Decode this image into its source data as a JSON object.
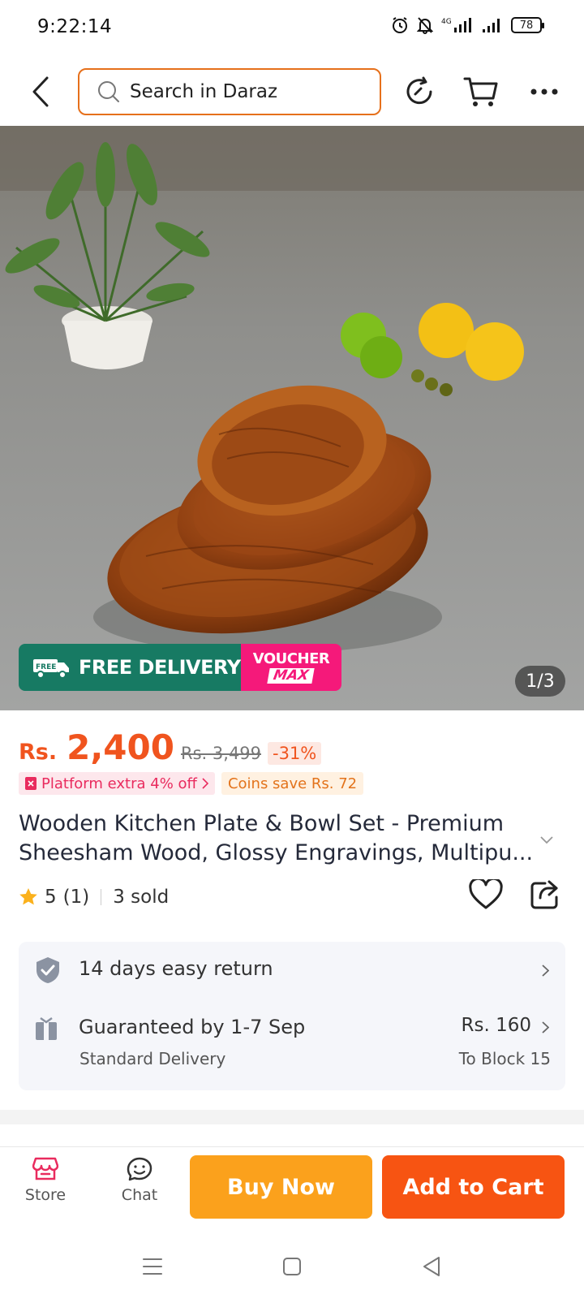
{
  "status_bar": {
    "time": "9:22:14",
    "network": "4G",
    "battery": "78"
  },
  "header": {
    "search_placeholder": "Search in Daraz"
  },
  "hero": {
    "promo_free_badge": "FREE",
    "promo_delivery": "FREE DELIVERY",
    "promo_voucher": "VOUCHER",
    "promo_max": "MAX",
    "image_counter": "1/3"
  },
  "price": {
    "currency": "Rs.",
    "current": "2,400",
    "original": "Rs. 3,499",
    "discount": "-31%"
  },
  "tags": {
    "platform": "Platform extra 4% off",
    "coins": "Coins save Rs. 72"
  },
  "product": {
    "title_line1": "Wooden Kitchen Plate & Bowl Set - Premium",
    "title_line2": "Sheesham Wood, Glossy Engravings, Multipu...",
    "rating": "5",
    "rating_count": "(1)",
    "sold": "3 sold"
  },
  "service": {
    "return_text": "14 days easy return",
    "delivery_text": "Guaranteed by 1-7 Sep",
    "delivery_type": "Standard Delivery",
    "delivery_price": "Rs. 160",
    "delivery_to": "To Block 15"
  },
  "bottom_bar": {
    "store_label": "Store",
    "chat_label": "Chat",
    "buy_now": "Buy Now",
    "add_to_cart": "Add to Cart"
  },
  "colors": {
    "accent": "#f75412",
    "buy_now": "#fba11c",
    "price": "#f0541e",
    "promo_green": "#177a63",
    "promo_pink": "#f5197a"
  }
}
